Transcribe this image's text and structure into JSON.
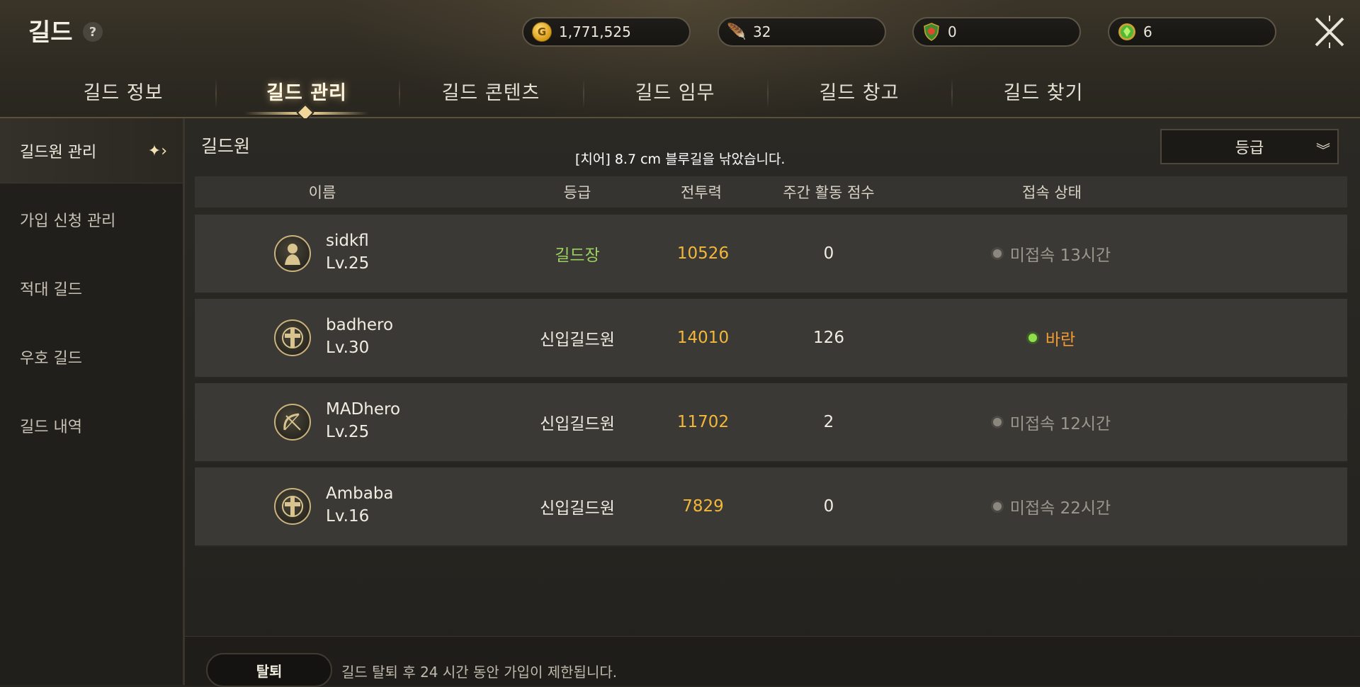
{
  "header": {
    "title": "길드",
    "help_icon": "?",
    "currencies": [
      {
        "icon": "gold-coin-icon",
        "value": "1,771,525"
      },
      {
        "icon": "feather-icon",
        "value": "32"
      },
      {
        "icon": "shield-token-icon",
        "value": "0"
      },
      {
        "icon": "green-gem-icon",
        "value": "6"
      }
    ]
  },
  "tabs": [
    {
      "label": "길드 정보",
      "active": false
    },
    {
      "label": "길드 관리",
      "active": true
    },
    {
      "label": "길드 콘텐츠",
      "active": false
    },
    {
      "label": "길드 임무",
      "active": false
    },
    {
      "label": "길드 창고",
      "active": false
    },
    {
      "label": "길드 찾기",
      "active": false
    }
  ],
  "sidebar": {
    "items": [
      {
        "label": "길드원 관리",
        "active": true
      },
      {
        "label": "가입 신청 관리",
        "active": false
      },
      {
        "label": "적대 길드",
        "active": false
      },
      {
        "label": "우호 길드",
        "active": false
      },
      {
        "label": "길드 내역",
        "active": false
      }
    ]
  },
  "main": {
    "section_title": "길드원",
    "chat_message": "[치어] 8.7 cm 블루길을 낚았습니다.",
    "sort_dropdown": {
      "selected": "등급"
    },
    "columns": [
      "이름",
      "등급",
      "전투력",
      "주간 활동 점수",
      "접속 상태"
    ],
    "members": [
      {
        "name": "sidkfl",
        "level": "Lv.25",
        "grade": "길드장",
        "power": "10526",
        "score": "0",
        "status": "미접속 13시간",
        "online": false,
        "class_icon": "bust-icon"
      },
      {
        "name": "badhero",
        "level": "Lv.30",
        "grade": "신입길드원",
        "power": "14010",
        "score": "126",
        "status": "바란",
        "online": true,
        "class_icon": "cross-shield-icon"
      },
      {
        "name": "MADhero",
        "level": "Lv.25",
        "grade": "신입길드원",
        "power": "11702",
        "score": "2",
        "status": "미접속 12시간",
        "online": false,
        "class_icon": "bow-icon"
      },
      {
        "name": "Ambaba",
        "level": "Lv.16",
        "grade": "신입길드원",
        "power": "7829",
        "score": "0",
        "status": "미접속 22시간",
        "online": false,
        "class_icon": "cross-shield-icon"
      }
    ]
  },
  "footer": {
    "leave_label": "탈퇴",
    "leave_note": "길드 탈퇴 후 24 시간 동안 가입이 제한됩니다."
  },
  "colors": {
    "leader_grade": "#9bd05f",
    "power": "#f3b83a",
    "online_status": "#f39a32",
    "offline_status": "#9c978d"
  }
}
